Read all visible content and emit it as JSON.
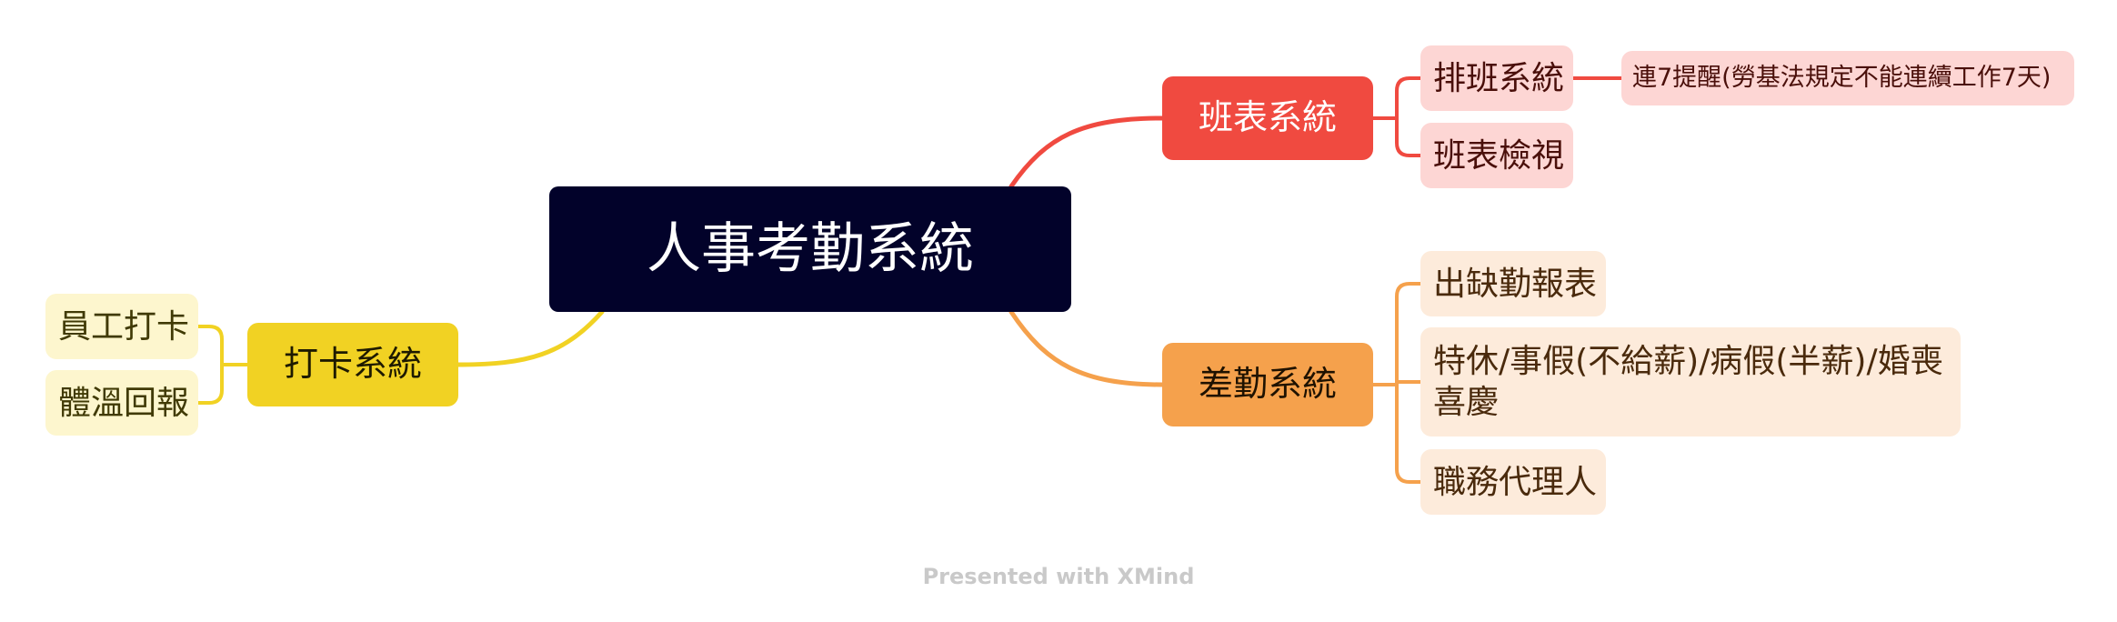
{
  "central": {
    "label": "人事考勤系統"
  },
  "branches": {
    "schedule": {
      "label": "班表系統",
      "color": "#f04a40",
      "children": [
        {
          "label": "排班系統",
          "children": [
            {
              "label": "連7提醒(勞基法規定不能連續工作7天)"
            }
          ]
        },
        {
          "label": "班表檢視"
        }
      ]
    },
    "attendance": {
      "label": "差勤系統",
      "color": "#f5a14c",
      "children": [
        {
          "label": "出缺勤報表"
        },
        {
          "label": "特休/事假(不給薪)/病假(半薪)/婚喪喜慶"
        },
        {
          "label": "職務代理人"
        }
      ]
    },
    "punch": {
      "label": "打卡系統",
      "color": "#f1d223",
      "children": [
        {
          "label": "員工打卡"
        },
        {
          "label": "體溫回報"
        }
      ]
    }
  },
  "footer": {
    "label": "Presented with XMind"
  }
}
